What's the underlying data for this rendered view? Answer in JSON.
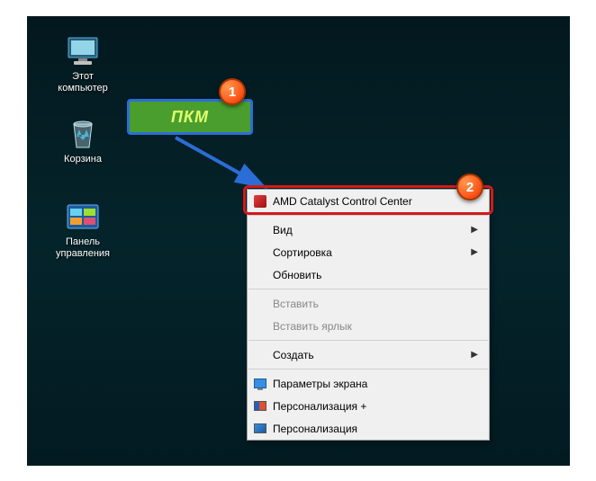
{
  "desktop": {
    "icons": {
      "computer": "Этот компьютер",
      "recycle_bin": "Корзина",
      "control_panel": "Панель управления"
    }
  },
  "callout": {
    "text": "ПКМ"
  },
  "badges": {
    "b1": "1",
    "b2": "2"
  },
  "context_menu": {
    "amd": "AMD Catalyst Control Center",
    "view": "Вид",
    "sort": "Сортировка",
    "refresh": "Обновить",
    "paste": "Вставить",
    "paste_shortcut": "Вставить ярлык",
    "new": "Создать",
    "display": "Параметры экрана",
    "personalize_plus": "Персонализация +",
    "personalize": "Персонализация"
  }
}
